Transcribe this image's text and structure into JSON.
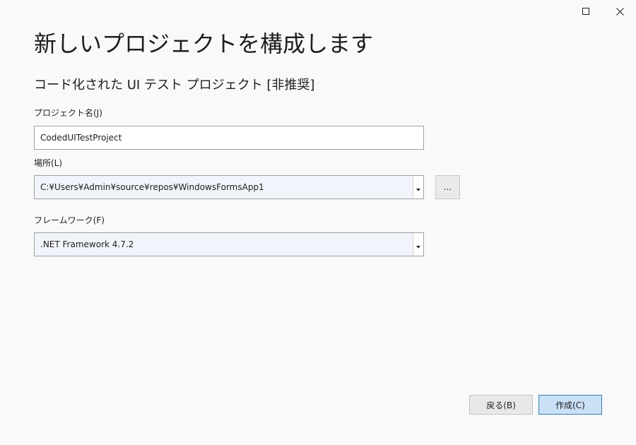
{
  "window": {
    "controls": [
      {
        "name": "maximize-icon"
      },
      {
        "name": "close-icon"
      }
    ]
  },
  "header": {
    "title": "新しいプロジェクトを構成します",
    "subtitle": "コード化された UI テスト プロジェクト [非推奨]"
  },
  "form": {
    "project_name": {
      "label": "プロジェクト名(J)",
      "value": "CodedUITestProject"
    },
    "location": {
      "label": "場所(L)",
      "value": "C:¥Users¥Admin¥source¥repos¥WindowsFormsApp1",
      "browse_label": "..."
    },
    "framework": {
      "label": "フレームワーク(F)",
      "value": ".NET Framework 4.7.2"
    }
  },
  "footer": {
    "back_label": "戻る(B)",
    "create_label": "作成(C)"
  },
  "colors": {
    "background": "#f9f9fb",
    "primary_button_bg": "#c9e0f7",
    "primary_button_border": "#3c7fb1",
    "combo_bg": "#f2f4fc"
  }
}
